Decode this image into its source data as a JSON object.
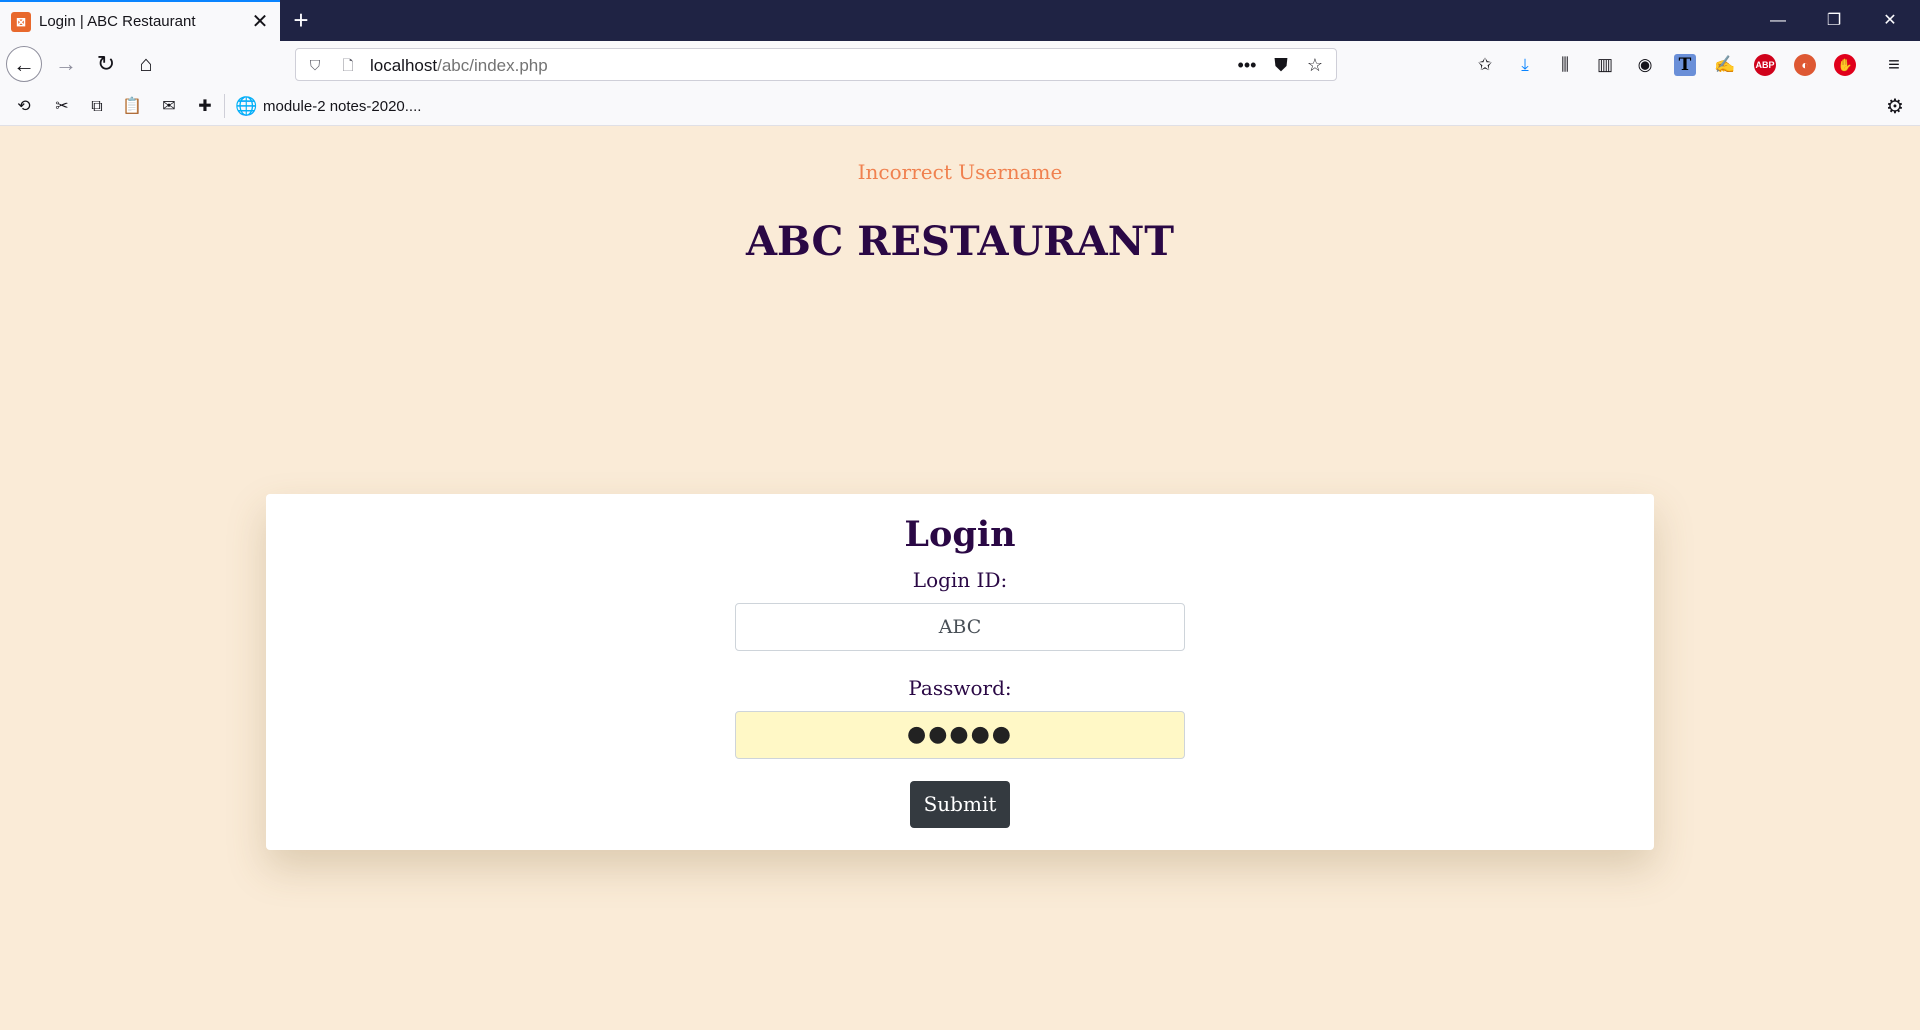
{
  "browser": {
    "tab": {
      "title": "Login | ABC Restaurant",
      "favicon": "xampp-icon",
      "close": "✕"
    },
    "new_tab": "+",
    "window_controls": [
      "minimize-icon",
      "restore-icon",
      "close-icon"
    ],
    "url": {
      "host": "localhost",
      "path": "/abc/index.php"
    },
    "page_actions_label": "•••",
    "bookmarks": [
      {
        "label": "module-2 notes-2020...."
      }
    ]
  },
  "page": {
    "error_message": "Incorrect Username",
    "site_title": "ABC RESTAURANT",
    "card": {
      "title": "Login",
      "login_label": "Login ID:",
      "login_value": "ABC",
      "password_label": "Password:",
      "password_masked": "●●●●●",
      "submit_label": "Submit"
    }
  },
  "colors": {
    "page_background": "#faebd7",
    "title_color": "#2a0845",
    "error_color": "#f0814f",
    "button_color": "#343a40",
    "autofill_color": "#fff8c6"
  }
}
